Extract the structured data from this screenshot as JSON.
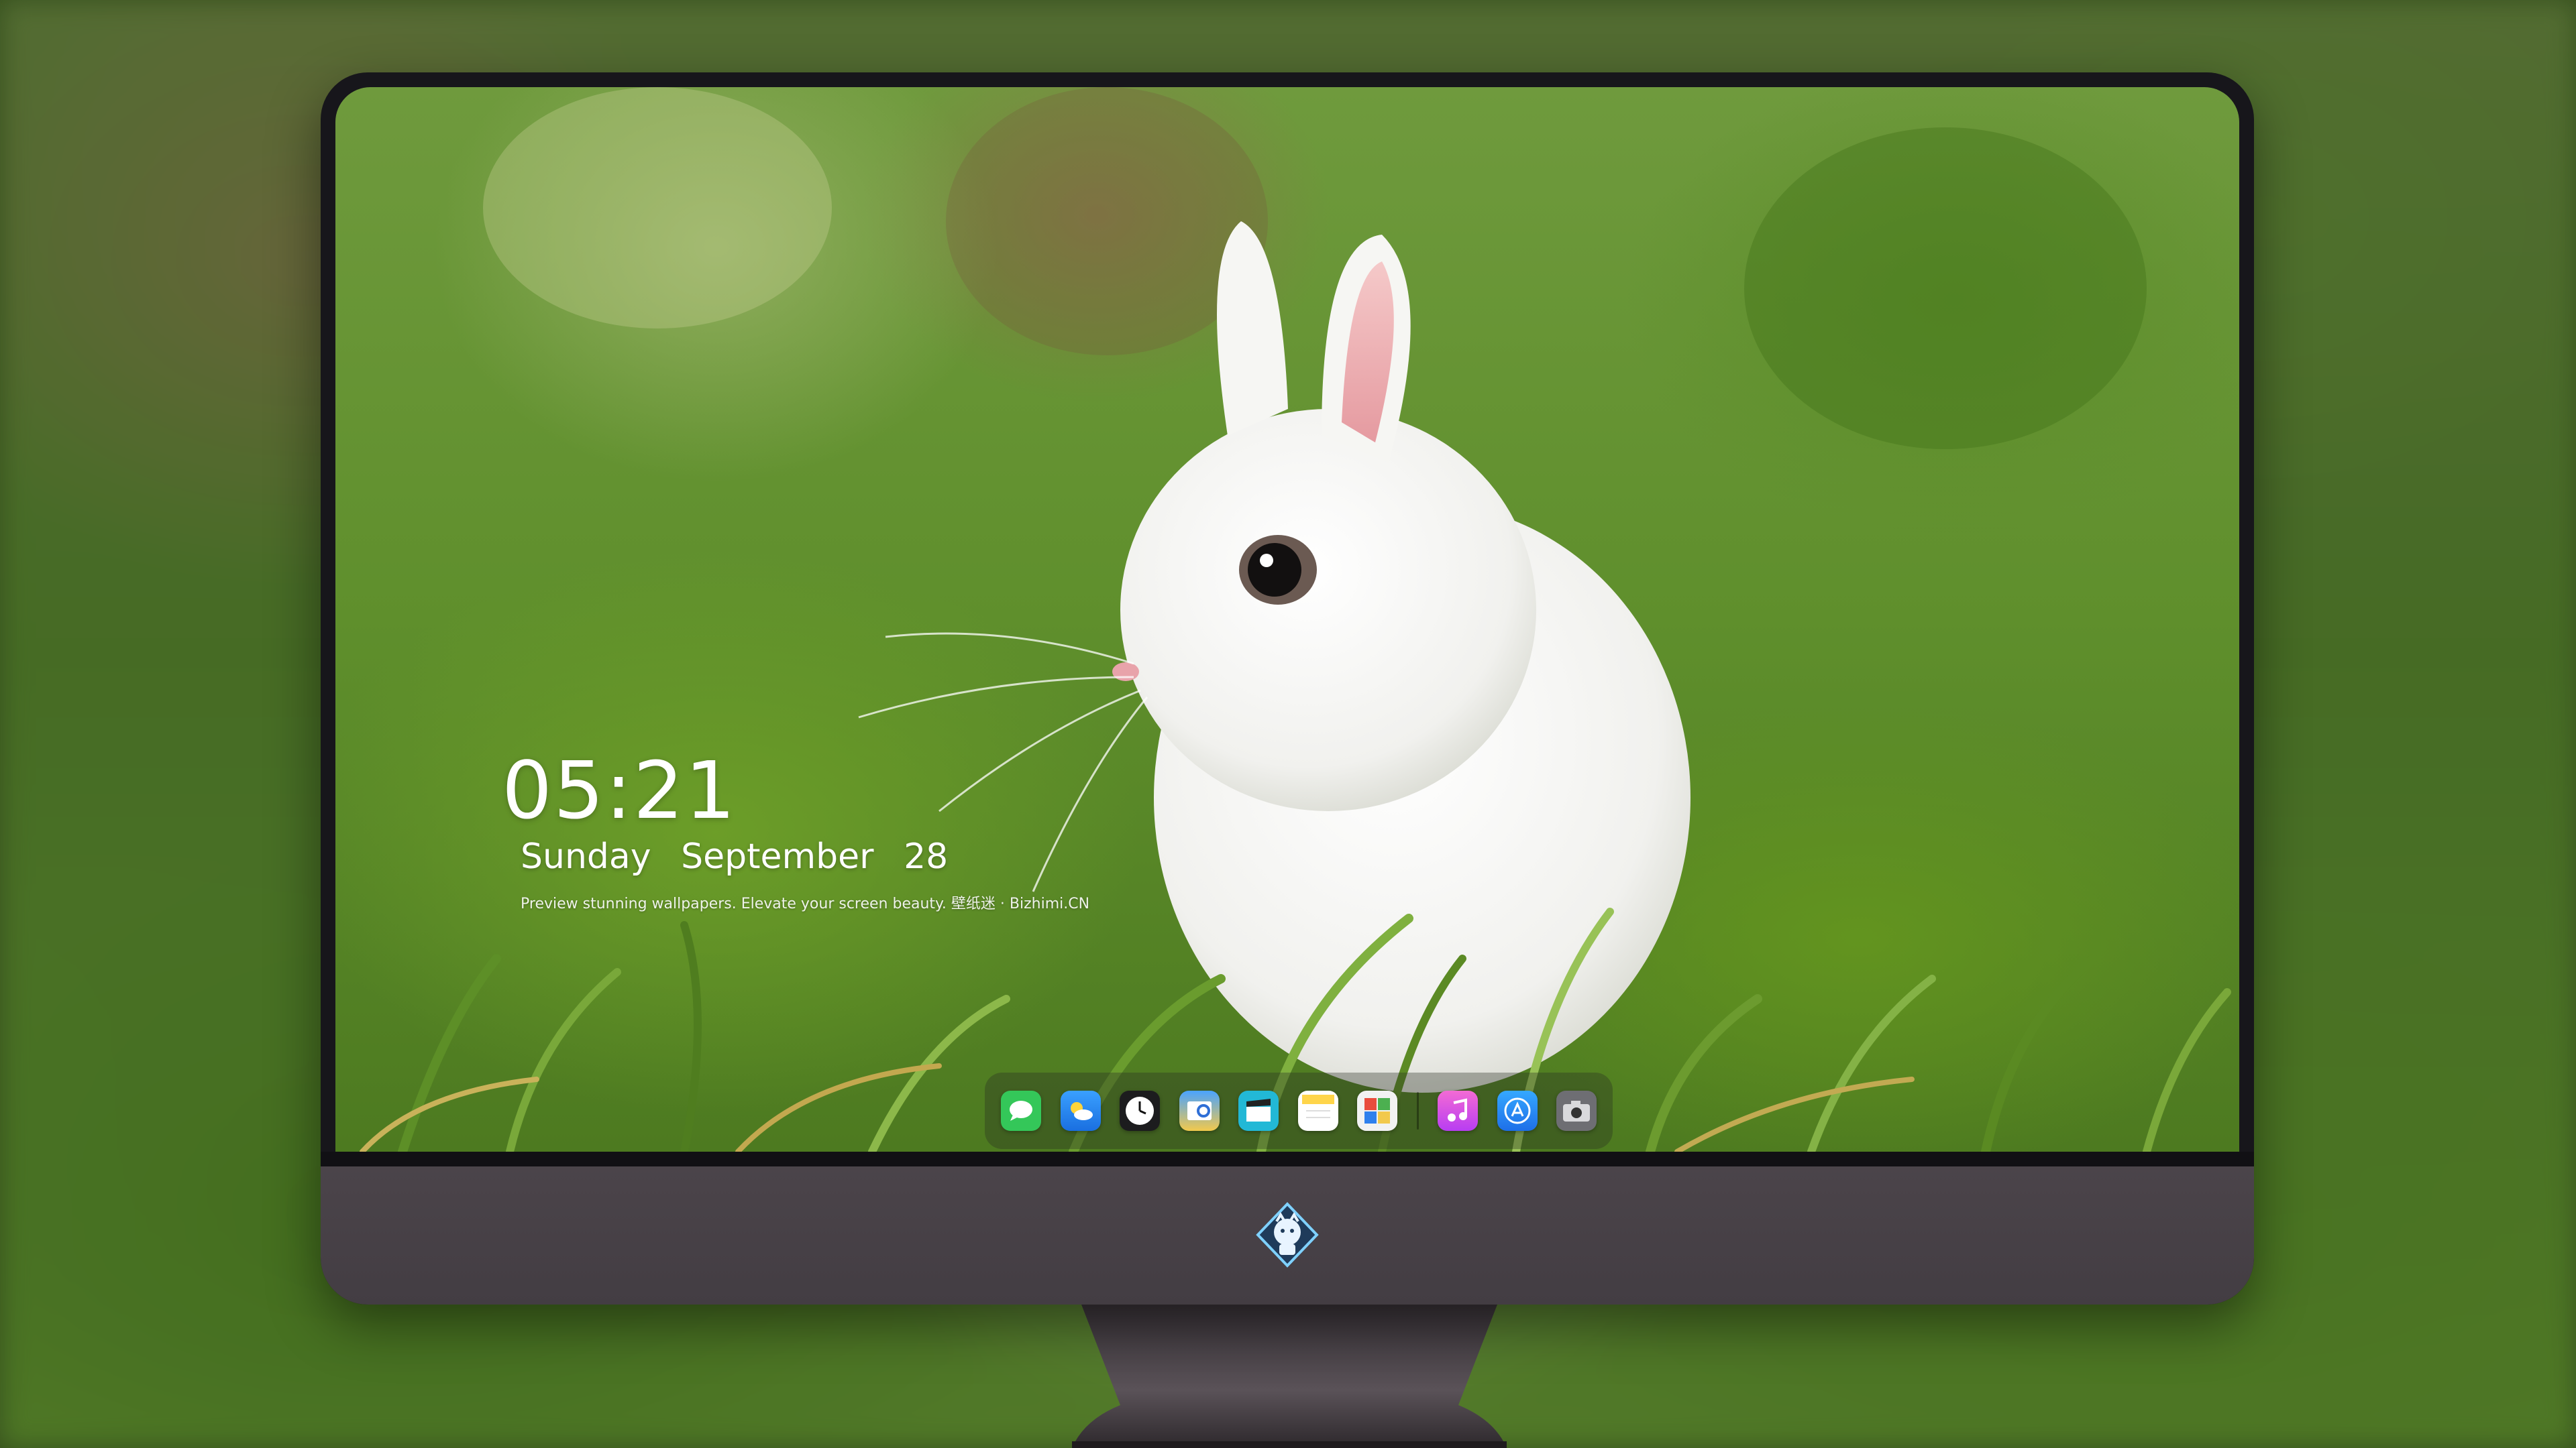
{
  "lockscreen": {
    "time": "05:21",
    "weekday": "Sunday",
    "month": "September",
    "day": "28",
    "tagline": "Preview stunning wallpapers. Elevate your screen beauty. 壁纸迷 · Bizhimi.CN"
  },
  "dock": {
    "apps": [
      {
        "name": "messages-icon",
        "color": "#34c759"
      },
      {
        "name": "weather-icon",
        "color": "#2f8dff"
      },
      {
        "name": "clock-icon",
        "color": "#1c1c1e"
      },
      {
        "name": "preview-icon",
        "color": "#f2c94c"
      },
      {
        "name": "clips-icon",
        "color": "#22b8d6"
      },
      {
        "name": "notes-icon",
        "color": "#ffd54a"
      },
      {
        "name": "photo-booth-icon",
        "color": "#e94c3d"
      },
      {
        "name": "music-icon",
        "color": "#e34cd6"
      },
      {
        "name": "app-store-icon",
        "color": "#1e88ff"
      },
      {
        "name": "camera-icon",
        "color": "#6e6e73"
      }
    ]
  },
  "colors": {
    "monitor_frame": "#17161b",
    "chin": "#4b444a",
    "text": "#ffffff"
  }
}
